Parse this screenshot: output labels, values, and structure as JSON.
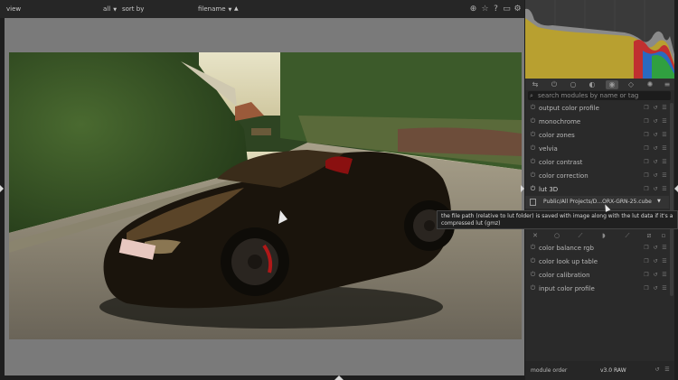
{
  "topbar": {
    "view_label": "view",
    "filter_value": "all",
    "sort_label": "sort by",
    "sort_value": "filename",
    "sort_dir": "▲",
    "icons": [
      "globe-icon",
      "star-icon",
      "help-icon",
      "preferences-icon",
      "gear-icon"
    ]
  },
  "panel": {
    "search_placeholder": "search modules by name or tag",
    "tabs": [
      "quick-access-icon",
      "power-icon",
      "base-icon",
      "tone-icon",
      "color-icon",
      "correct-icon",
      "effect-icon",
      "presets-icon"
    ],
    "modules": [
      {
        "label": "output color profile"
      },
      {
        "label": "monochrome"
      },
      {
        "label": "color zones"
      },
      {
        "label": "velvia"
      },
      {
        "label": "color contrast"
      },
      {
        "label": "color correction"
      },
      {
        "label": "lut 3D"
      }
    ],
    "lut_file": "Public/All Projects/D...ORX-GRN-25.cube",
    "tooltip": "the file path (relative to lut folder) is saved with image along with the lut data if it's a compressed lut (gmz)",
    "modules_after": [
      {
        "label": "color balance rgb"
      },
      {
        "label": "color look up table"
      },
      {
        "label": "color calibration"
      },
      {
        "label": "input color profile"
      }
    ],
    "footer": {
      "label": "module order",
      "version": "v3.0 RAW"
    }
  },
  "colors": {
    "panel_bg": "#2a2a2a",
    "center_bg": "#7a7a7a",
    "active_tab": "#505050"
  }
}
